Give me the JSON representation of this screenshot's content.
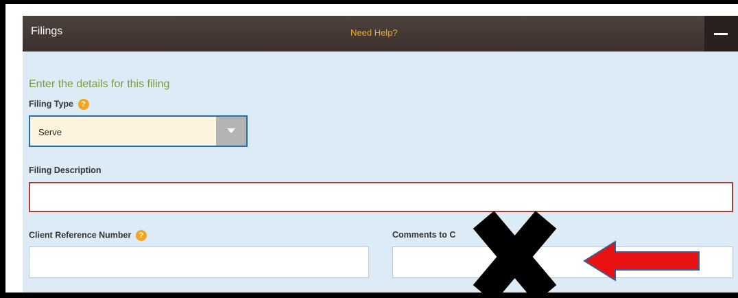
{
  "panel": {
    "title": "Filings",
    "help_link": "Need Help?",
    "collapse_icon": "minus-icon"
  },
  "form": {
    "intro": "Enter the details for this filing",
    "filing_type": {
      "label": "Filing Type",
      "value": "Serve"
    },
    "filing_description": {
      "label": "Filing Description",
      "value": ""
    },
    "client_reference_number": {
      "label": "Client Reference Number",
      "value": ""
    },
    "comments": {
      "label": "Comments to C",
      "value": ""
    }
  },
  "annotations": {
    "cross_mark": "x-mark-icon",
    "arrow": "left-arrow-icon",
    "arrow_color": "#e81212",
    "cross_color": "#000000"
  },
  "colors": {
    "header_bg": "#3f3430",
    "help_link": "#f0a81c",
    "panel_bg": "#dcebf5",
    "intro_text": "#7a9a3e",
    "help_icon": "#f2a51e",
    "select_border": "#1f6fb1",
    "select_bg": "#fdf3de",
    "error_border": "#b03a36"
  }
}
